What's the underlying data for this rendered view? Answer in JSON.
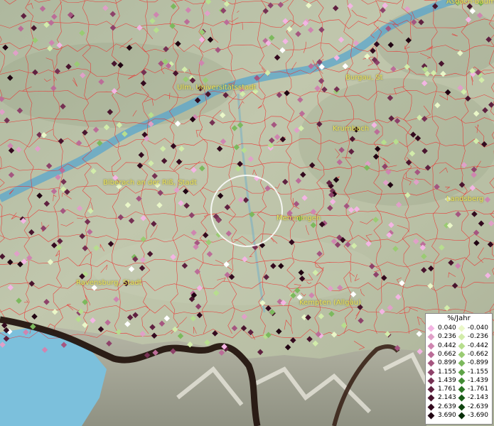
{
  "map": {
    "cities": [
      {
        "id": "ulm",
        "label": "Ulm, Universitätsstadt"
      },
      {
        "id": "burgau",
        "label": "Burgau, St"
      },
      {
        "id": "biberach",
        "label": "Biberach an der Riß, Stadt"
      },
      {
        "id": "memmingen",
        "label": "Memmingen"
      },
      {
        "id": "ravensburg",
        "label": "Ravensburg, Stadt"
      },
      {
        "id": "kempten",
        "label": "Kempten (Allgäu)"
      },
      {
        "id": "landsberg",
        "label": "Landsberg"
      },
      {
        "id": "krumbach",
        "label": "Krumbach"
      },
      {
        "id": "asbach",
        "label": "Asbach-Bäumenheim"
      }
    ],
    "legend": {
      "title": "%/Jahr",
      "rows": [
        {
          "pos": "0.040",
          "neg": "-0.040",
          "pos_color": "#f3b5e3",
          "neg_color": "#eaf7c8"
        },
        {
          "pos": "0.236",
          "neg": "-0.236",
          "pos_color": "#e0a0c8",
          "neg_color": "#d2ecaa"
        },
        {
          "pos": "0.442",
          "neg": "-0.442",
          "pos_color": "#cf85b0",
          "neg_color": "#b7de8e"
        },
        {
          "pos": "0.662",
          "neg": "-0.662",
          "pos_color": "#bb6d98",
          "neg_color": "#9acb73"
        },
        {
          "pos": "0.899",
          "neg": "-0.899",
          "pos_color": "#a55680",
          "neg_color": "#7cb95d"
        },
        {
          "pos": "1.155",
          "neg": "-1.155",
          "pos_color": "#8e426a",
          "neg_color": "#5ea348"
        },
        {
          "pos": "1.439",
          "neg": "-1.439",
          "pos_color": "#763153",
          "neg_color": "#438c36"
        },
        {
          "pos": "1.761",
          "neg": "-1.761",
          "pos_color": "#5f2140",
          "neg_color": "#2c7526"
        },
        {
          "pos": "2.143",
          "neg": "-2.143",
          "pos_color": "#49152e",
          "neg_color": "#1b5d1a"
        },
        {
          "pos": "2.639",
          "neg": "-2.639",
          "pos_color": "#330a1e",
          "neg_color": "#0f4410"
        },
        {
          "pos": "3.690",
          "neg": "-3.690",
          "pos_color": "#200412",
          "neg_color": "#062d07"
        }
      ]
    },
    "colors": {
      "boundary": "#ee2a2a",
      "river": "#4d9ec4",
      "lake": "#7cc0dc",
      "border": "#2a1a12",
      "halo": "#ffffff"
    }
  }
}
